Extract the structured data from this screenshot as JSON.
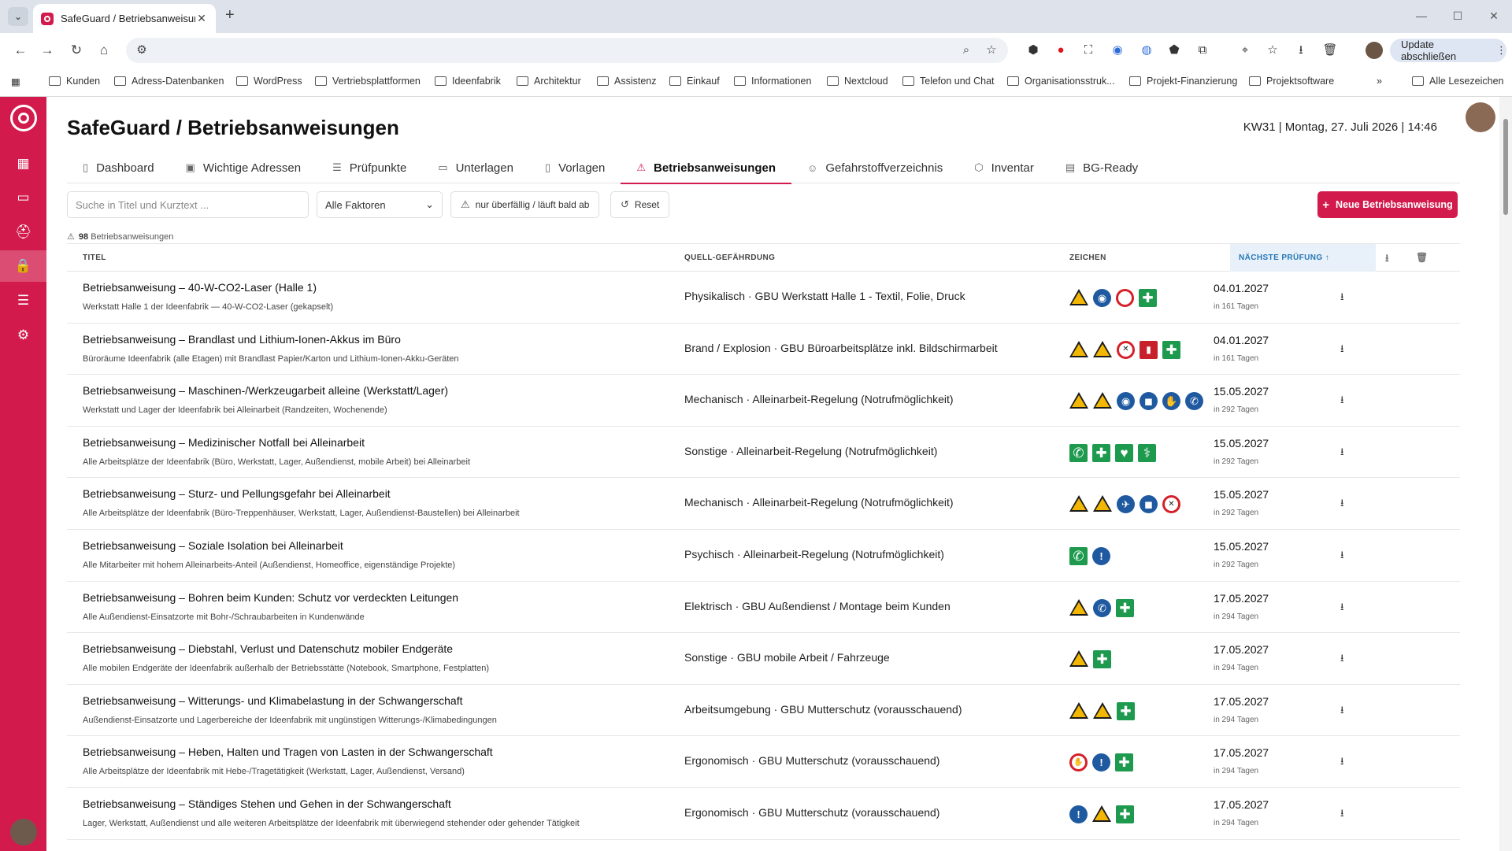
{
  "browser": {
    "tab_title": "SafeGuard / Betriebsanweisungen",
    "new_tab": "+",
    "update_label": "Update abschließen",
    "bookmarks": [
      "Kunden",
      "Adress-Datenbanken",
      "WordPress",
      "Vertriebsplattformen",
      "Ideenfabrik",
      "Architektur",
      "Assistenz",
      "Einkauf",
      "Informationen",
      "Nextcloud",
      "Telefon und Chat",
      "Organisationsstruk...",
      "Projekt-Finanzierung",
      "Projektsoftware"
    ],
    "bookmarks_more": "»",
    "bookmarks_all": "Alle Lesezeichen"
  },
  "app": {
    "title": "SafeGuard / Betriebsanweisungen",
    "datetime": "KW31 | Montag, 27. Juli 2026 | 14:46",
    "accent_color": "#d21b4c",
    "sidebar_icons": [
      "grid-icon",
      "briefcase-icon",
      "first-aid-icon",
      "lock-icon",
      "database-icon",
      "gear-icon"
    ],
    "tabs": [
      {
        "label": "Dashboard",
        "icon": "document-icon"
      },
      {
        "label": "Wichtige Adressen",
        "icon": "address-icon"
      },
      {
        "label": "Prüfpunkte",
        "icon": "list-icon"
      },
      {
        "label": "Unterlagen",
        "icon": "folder-icon"
      },
      {
        "label": "Vorlagen",
        "icon": "template-icon"
      },
      {
        "label": "Betriebsanweisungen",
        "icon": "warning-icon",
        "active": true
      },
      {
        "label": "Gefahrstoffverzeichnis",
        "icon": "hazard-person-icon"
      },
      {
        "label": "Inventar",
        "icon": "box-icon"
      },
      {
        "label": "BG-Ready",
        "icon": "clipboard-icon"
      }
    ]
  },
  "filters": {
    "search_placeholder": "Suche in Titel und Kurztext ...",
    "factor_select": "Alle Faktoren",
    "overdue_toggle": "nur überfällig / läuft bald ab",
    "reset_label": "Reset",
    "new_button": "Neue Betriebsanweisung"
  },
  "count": {
    "number": "98",
    "label": "Betriebsanweisungen"
  },
  "table": {
    "headers": {
      "title": "TITEL",
      "source": "QUELL-GEFÄHRDUNG",
      "signs": "ZEICHEN",
      "next_check": "NÄCHSTE PRÜFUNG ↑"
    },
    "rows": [
      {
        "title": "Betriebsanweisung – 40-W-CO2-Laser (Halle 1)",
        "subtitle": "Werkstatt Halle 1 der Ideenfabrik — 40-W-CO2-Laser (gekapselt)",
        "source": "Physikalisch · GBU Werkstatt Halle 1 - Textil, Folie, Druck",
        "signs": [
          "warning",
          "blue:◉",
          "proh:",
          "green:✚"
        ],
        "date": "04.01.2027",
        "days": "in 161 Tagen"
      },
      {
        "title": "Betriebsanweisung – Brandlast und Lithium-Ionen-Akkus im Büro",
        "subtitle": "Büroräume Ideenfabrik (alle Etagen) mit Brandlast Papier/Karton und Lithium-Ionen-Akku-Geräten",
        "source": "Brand / Explosion · GBU Büroarbeitsplätze inkl. Bildschirmarbeit",
        "signs": [
          "warning",
          "warning",
          "proh:✕",
          "fire:▮",
          "green:✚"
        ],
        "date": "04.01.2027",
        "days": "in 161 Tagen"
      },
      {
        "title": "Betriebsanweisung – Maschinen-/Werkzeugarbeit alleine (Werkstatt/Lager)",
        "subtitle": "Werkstatt und Lager der Ideenfabrik bei Alleinarbeit (Randzeiten, Wochenende)",
        "source": "Mechanisch · Alleinarbeit-Regelung (Notrufmöglichkeit)",
        "signs": [
          "warning",
          "warning",
          "blue:◉",
          "blue:◼",
          "blue:✋",
          "blue:✆"
        ],
        "date": "15.05.2027",
        "days": "in 292 Tagen"
      },
      {
        "title": "Betriebsanweisung – Medizinischer Notfall bei Alleinarbeit",
        "subtitle": "Alle Arbeitsplätze der Ideenfabrik (Büro, Werkstatt, Lager, Außendienst, mobile Arbeit) bei Alleinarbeit",
        "source": "Sonstige · Alleinarbeit-Regelung (Notrufmöglichkeit)",
        "signs": [
          "green:✆",
          "green:✚",
          "green:♥",
          "green:⚕"
        ],
        "date": "15.05.2027",
        "days": "in 292 Tagen"
      },
      {
        "title": "Betriebsanweisung – Sturz- und Pellungsgefahr bei Alleinarbeit",
        "subtitle": "Alle Arbeitsplätze der Ideenfabrik (Büro-Treppenhäuser, Werkstatt, Lager, Außendienst-Baustellen) bei Alleinarbeit",
        "source": "Mechanisch · Alleinarbeit-Regelung (Notrufmöglichkeit)",
        "signs": [
          "warning",
          "warning",
          "blue:✈",
          "blue:◼",
          "proh:✕"
        ],
        "date": "15.05.2027",
        "days": "in 292 Tagen"
      },
      {
        "title": "Betriebsanweisung – Soziale Isolation bei Alleinarbeit",
        "subtitle": "Alle Mitarbeiter mit hohem Alleinarbeits-Anteil (Außendienst, Homeoffice, eigenständige Projekte)",
        "source": "Psychisch · Alleinarbeit-Regelung (Notrufmöglichkeit)",
        "signs": [
          "green:✆",
          "blue:!"
        ],
        "date": "15.05.2027",
        "days": "in 292 Tagen"
      },
      {
        "title": "Betriebsanweisung – Bohren beim Kunden: Schutz vor verdeckten Leitungen",
        "subtitle": "Alle Außendienst-Einsatzorte mit Bohr-/Schraubarbeiten in Kundenwände",
        "source": "Elektrisch · GBU Außendienst / Montage beim Kunden",
        "signs": [
          "warning",
          "blue:✆",
          "green:✚"
        ],
        "date": "17.05.2027",
        "days": "in 294 Tagen"
      },
      {
        "title": "Betriebsanweisung – Diebstahl, Verlust und Datenschutz mobiler Endgeräte",
        "subtitle": "Alle mobilen Endgeräte der Ideenfabrik außerhalb der Betriebsstätte (Notebook, Smartphone, Festplatten)",
        "source": "Sonstige · GBU mobile Arbeit / Fahrzeuge",
        "signs": [
          "warning",
          "green:✚"
        ],
        "date": "17.05.2027",
        "days": "in 294 Tagen"
      },
      {
        "title": "Betriebsanweisung – Witterungs- und Klimabelastung in der Schwangerschaft",
        "subtitle": "Außendienst-Einsatzorte und Lagerbereiche der Ideenfabrik mit ungünstigen Witterungs-/Klimabedingungen",
        "source": "Arbeitsumgebung · GBU Mutterschutz (vorausschauend)",
        "signs": [
          "warning",
          "warning",
          "green:✚"
        ],
        "date": "17.05.2027",
        "days": "in 294 Tagen"
      },
      {
        "title": "Betriebsanweisung – Heben, Halten und Tragen von Lasten in der Schwangerschaft",
        "subtitle": "Alle Arbeitsplätze der Ideenfabrik mit Hebe-/Tragetätigkeit (Werkstatt, Lager, Außendienst, Versand)",
        "source": "Ergonomisch · GBU Mutterschutz (vorausschauend)",
        "signs": [
          "proh:✋",
          "blue:!",
          "green:✚"
        ],
        "date": "17.05.2027",
        "days": "in 294 Tagen"
      },
      {
        "title": "Betriebsanweisung – Ständiges Stehen und Gehen in der Schwangerschaft",
        "subtitle": "Lager, Werkstatt, Außendienst und alle weiteren Arbeitsplätze der Ideenfabrik mit überwiegend stehender oder gehender Tätigkeit",
        "source": "Ergonomisch · GBU Mutterschutz (vorausschauend)",
        "signs": [
          "blue:!",
          "warning",
          "green:✚"
        ],
        "date": "17.05.2027",
        "days": "in 294 Tagen"
      }
    ]
  }
}
